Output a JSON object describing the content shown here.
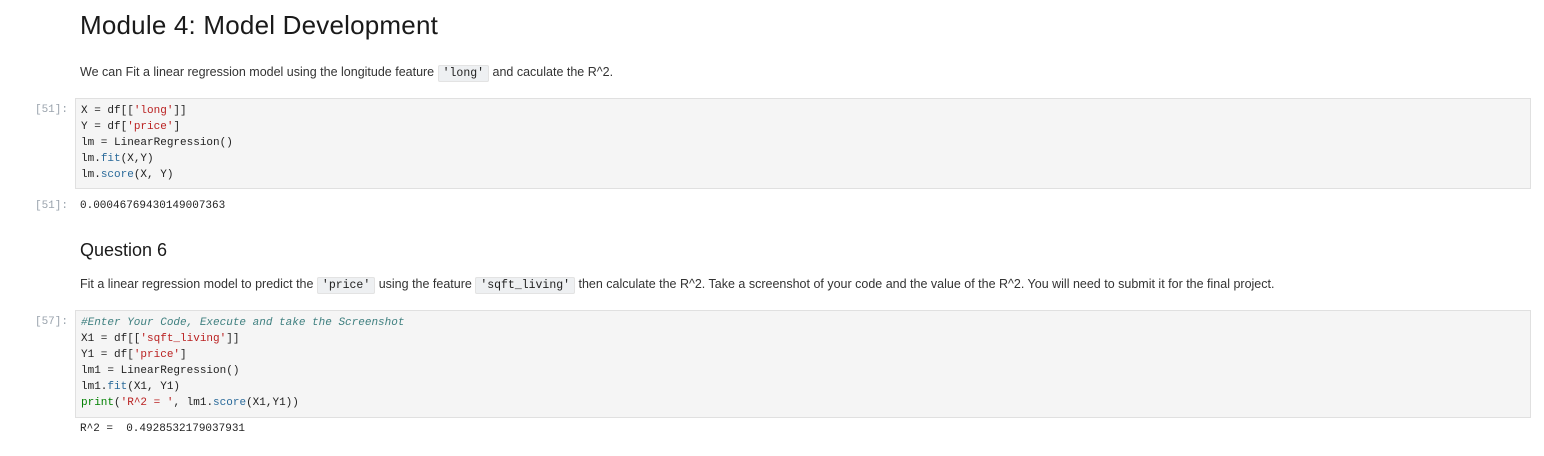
{
  "heading": "Module 4: Model Development",
  "intro": {
    "text_before": "We can Fit a linear regression model using the longitude feature ",
    "code": "'long'",
    "text_after": " and caculate the R^2."
  },
  "cell1": {
    "prompt": "[51]:",
    "lines": [
      "X = df[['long']]",
      "Y = df['price']",
      "lm = LinearRegression()",
      "lm.fit(X,Y)",
      "lm.score(X, Y)"
    ],
    "output_prompt": "[51]:",
    "output": "0.00046769430149007363"
  },
  "question": {
    "title": "Question 6",
    "text1": "Fit a linear regression model to predict the ",
    "code1": "'price'",
    "text2": " using the feature ",
    "code2": "'sqft_living'",
    "text3": " then calculate the R^2. Take a screenshot of your code and the value of the R^2. You will need to submit it for the final project."
  },
  "cell2": {
    "prompt": "[57]:",
    "lines": [
      "#Enter Your Code, Execute and take the Screenshot",
      "X1 = df[['sqft_living']]",
      "Y1 = df['price']",
      "lm1 = LinearRegression()",
      "lm1.fit(X1, Y1)",
      "print('R^2 = ', lm1.score(X1,Y1))"
    ],
    "output": "R^2 =  0.4928532179037931"
  }
}
